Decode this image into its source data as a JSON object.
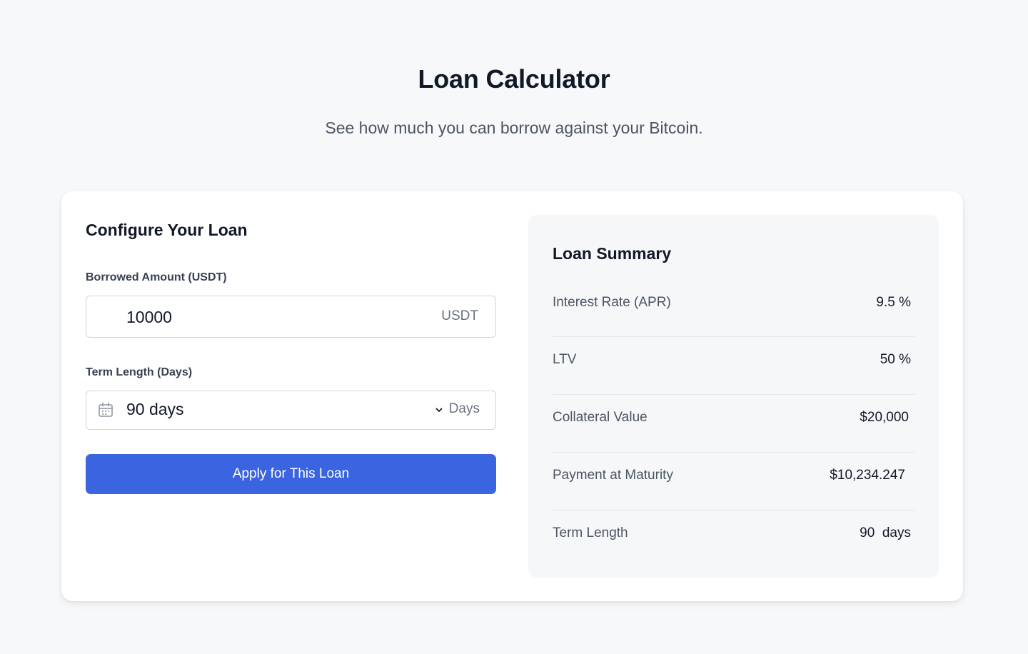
{
  "header": {
    "title": "Loan Calculator",
    "subtitle": "See how much you can borrow against your Bitcoin."
  },
  "config": {
    "title": "Configure Your Loan",
    "amount": {
      "label": "Borrowed Amount (USDT)",
      "value": "10000",
      "suffix": "USDT"
    },
    "term": {
      "label": "Term Length (Days)",
      "selected": "90 days",
      "suffix": "Days",
      "icon": "calendar-icon"
    },
    "apply_button": "Apply for This Loan"
  },
  "summary": {
    "title": "Loan Summary",
    "rows": [
      {
        "label": "Interest Rate (APR)",
        "value": "9.5 %"
      },
      {
        "label": "LTV",
        "value": "50 %"
      },
      {
        "label": "Collateral Value",
        "value": "$20,000"
      },
      {
        "label": "Payment at Maturity",
        "value": "$10,234.247"
      },
      {
        "label": "Term Length",
        "value": "90  days"
      }
    ]
  },
  "colors": {
    "accent": "#3b64e0",
    "background": "#f7f8fa",
    "card": "#ffffff",
    "summary_panel": "#f6f7f9"
  }
}
